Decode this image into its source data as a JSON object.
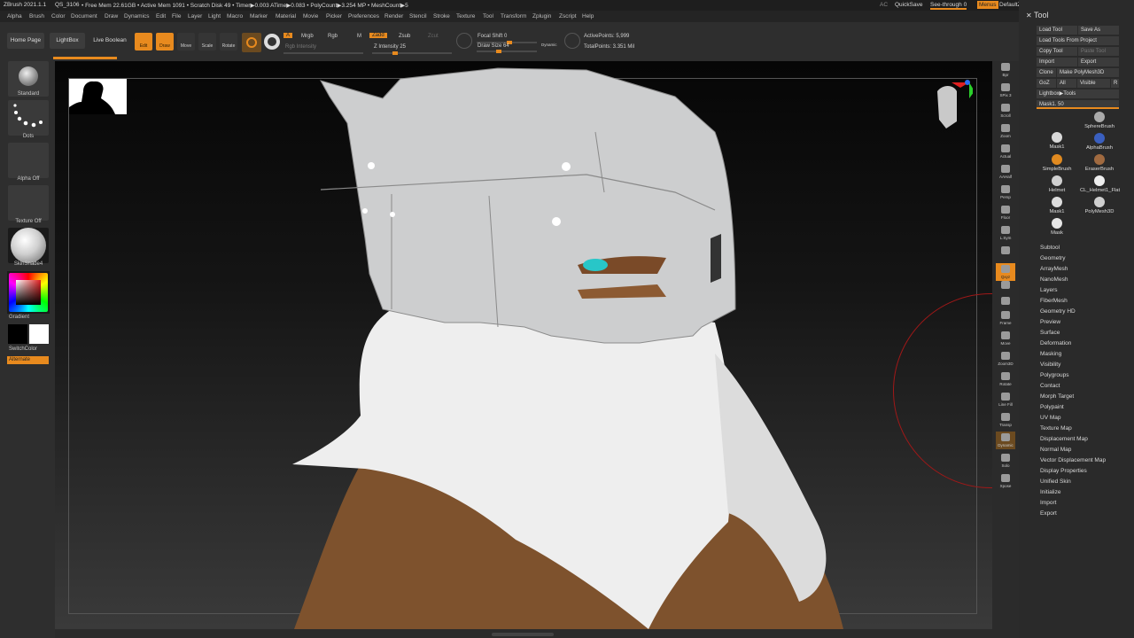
{
  "titlebar": {
    "app_name": "ZBrush 2021.1.1",
    "doc_name": "QS_3106",
    "stats": "• Free Mem 22.61GB • Active Mem 1091 • Scratch Disk 49 • Timer▶0.003 ATime▶0.083 • PolyCount▶3.254 MP • MeshCount▶5",
    "ac": "AC",
    "quicksave": "QuickSave",
    "see_through": "See-through  0",
    "menus": "Menus",
    "default_zscript": "DefaultZScript"
  },
  "menubar": {
    "items": [
      "Alpha",
      "Brush",
      "Color",
      "Document",
      "Draw",
      "Dynamics",
      "Edit",
      "File",
      "Layer",
      "Light",
      "Macro",
      "Marker",
      "Material",
      "Movie",
      "Picker",
      "Preferences",
      "Render",
      "Stencil",
      "Stroke",
      "Texture",
      "Tool",
      "Transform",
      "Zplugin",
      "Zscript",
      "Help"
    ]
  },
  "toolbar": {
    "home_page": "Home Page",
    "lightbox": "LightBox",
    "live_boolean": "Live Boolean",
    "edit": "Edit",
    "draw": "Draw",
    "move": "Move",
    "scale": "Scale",
    "rotate": "Rotate",
    "a_btn": "A",
    "mrgb": "Mrgb",
    "rgb": "Rgb",
    "m": "M",
    "zadd": "Zadd",
    "zsub": "Zsub",
    "zcut": "Zcut",
    "rgb_intensity": "Rgb Intensity",
    "z_intensity": "Z Intensity 25",
    "focal_shift": "Focal Shift 0",
    "draw_size": "Draw Size 64",
    "dynamic": "Dynamic",
    "active_points": "ActivePoints: 5,999",
    "total_points": "TotalPoints: 3.351 Mil",
    "z_intensity_fraction": 0.25,
    "focal_shift_fraction": 0.5,
    "draw_size_fraction": 0.32
  },
  "leftshelf": {
    "brush": "Standard",
    "stroke": "Dots",
    "alpha": "Alpha Off",
    "texture": "Texture Off",
    "material": "SkinShade4",
    "gradient": "Gradient",
    "switch_color": "SwitchColor",
    "alternate": "Alternate"
  },
  "righticons": [
    "Bpr",
    "SPix 3",
    "Scroll",
    "Zoom",
    "Actual",
    "AAHalf",
    "Persp",
    "Floor",
    "L.Sym",
    "",
    "Qxyz",
    "",
    "",
    "Frame",
    "Move",
    "Zoom3D",
    "Rotate",
    "Line Fill",
    "Transp",
    "Dynamic",
    "Solo",
    "Xpose"
  ],
  "toolpanel": {
    "title": "Tool",
    "load_tool": "Load Tool",
    "save_as": "Save As",
    "load_from_project": "Load Tools From Project",
    "copy_tool": "Copy Tool",
    "paste_tool": "Paste Tool",
    "import": "Import",
    "export": "Export",
    "clone": "Clone",
    "make_polymesh": "Make PolyMesh3D",
    "goz": "GoZ",
    "all": "All",
    "visible": "Visible",
    "r": "R",
    "lightbox_tools": "Lightbox▶Tools",
    "mask_slider": "Mask1. 50",
    "tiles": [
      {
        "label": "SphereBrush",
        "color": "#aaaaaa"
      },
      {
        "label": "Mask1",
        "color": "#d9d9d9"
      },
      {
        "label": "AlphaBrush",
        "color": "#3a5fbf"
      },
      {
        "label": "SimpleBrush",
        "color": "#e08a20"
      },
      {
        "label": "EraserBrush",
        "color": "#a06a40"
      },
      {
        "label": "Helmet",
        "color": "#cfcfcf"
      },
      {
        "label": "CL_Helmet1_Flat",
        "color": "#eeeeee"
      },
      {
        "label": "Mask1",
        "color": "#dddddd"
      },
      {
        "label": "PolyMesh3D",
        "color": "#cfcfcf"
      },
      {
        "label": "Mask",
        "color": "#e6e6e6"
      }
    ],
    "subpalettes": [
      "Subtool",
      "Geometry",
      "ArrayMesh",
      "NanoMesh",
      "Layers",
      "FiberMesh",
      "Geometry HD",
      "Preview",
      "Surface",
      "Deformation",
      "Masking",
      "Visibility",
      "Polygroups",
      "Contact",
      "Morph Target",
      "Polypaint",
      "UV Map",
      "Texture Map",
      "Displacement Map",
      "Normal Map",
      "Vector Displacement Map",
      "Display Properties",
      "Unified Skin",
      "Initialize",
      "Import",
      "Export"
    ]
  },
  "colors": {
    "accent": "#e88a1e",
    "helmet": "#cfd0d2",
    "skin": "#8a5a32",
    "hood": "#ececec",
    "eye": "#28c6c8"
  }
}
